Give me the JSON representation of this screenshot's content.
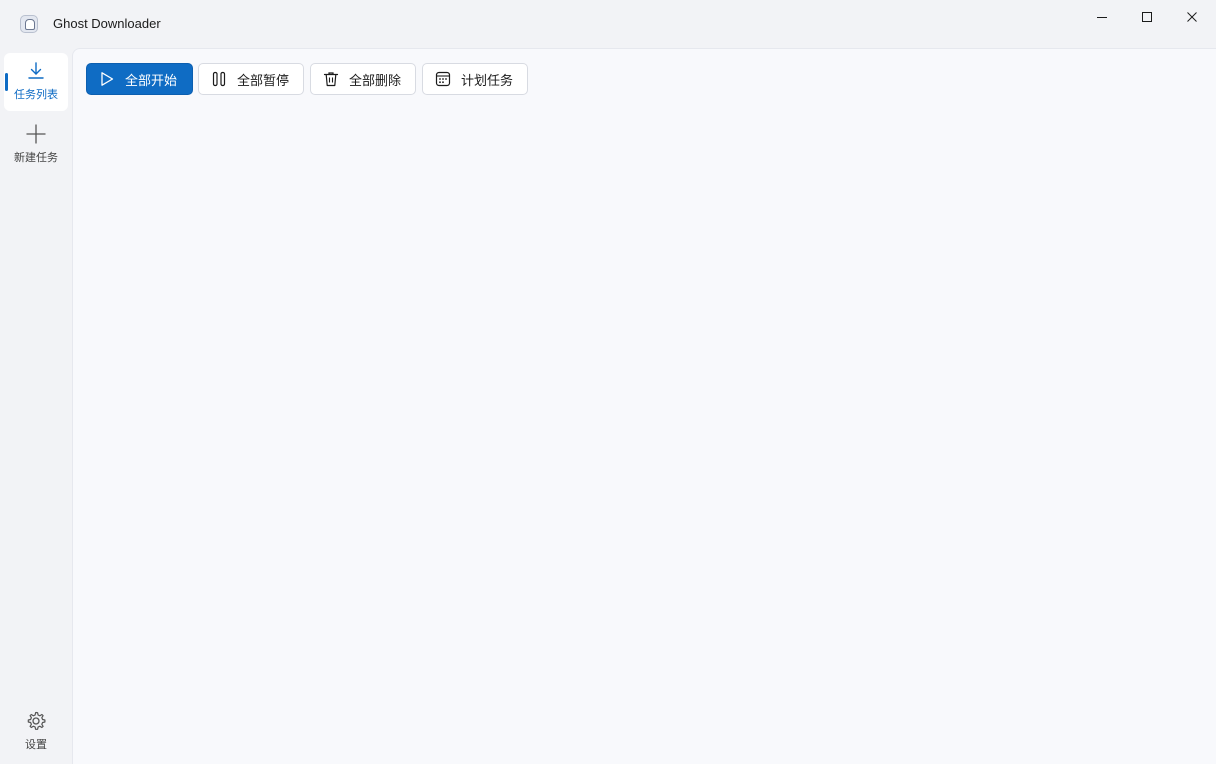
{
  "window": {
    "title": "Ghost Downloader",
    "controls": [
      "minimize-icon",
      "maximize-icon",
      "close-icon"
    ]
  },
  "sidebar": {
    "items": [
      {
        "label": "任务列表",
        "icon": "download-icon",
        "active": true
      },
      {
        "label": "新建任务",
        "icon": "plus-icon",
        "active": false
      }
    ],
    "bottom": {
      "label": "设置",
      "icon": "gear-icon"
    }
  },
  "toolbar": {
    "start_all": "全部开始",
    "pause_all": "全部暂停",
    "delete_all": "全部删除",
    "schedule": "计划任务"
  },
  "colors": {
    "accent": "#0f6cc4",
    "background": "#f2f3f6",
    "content": "#f8f9fc"
  }
}
